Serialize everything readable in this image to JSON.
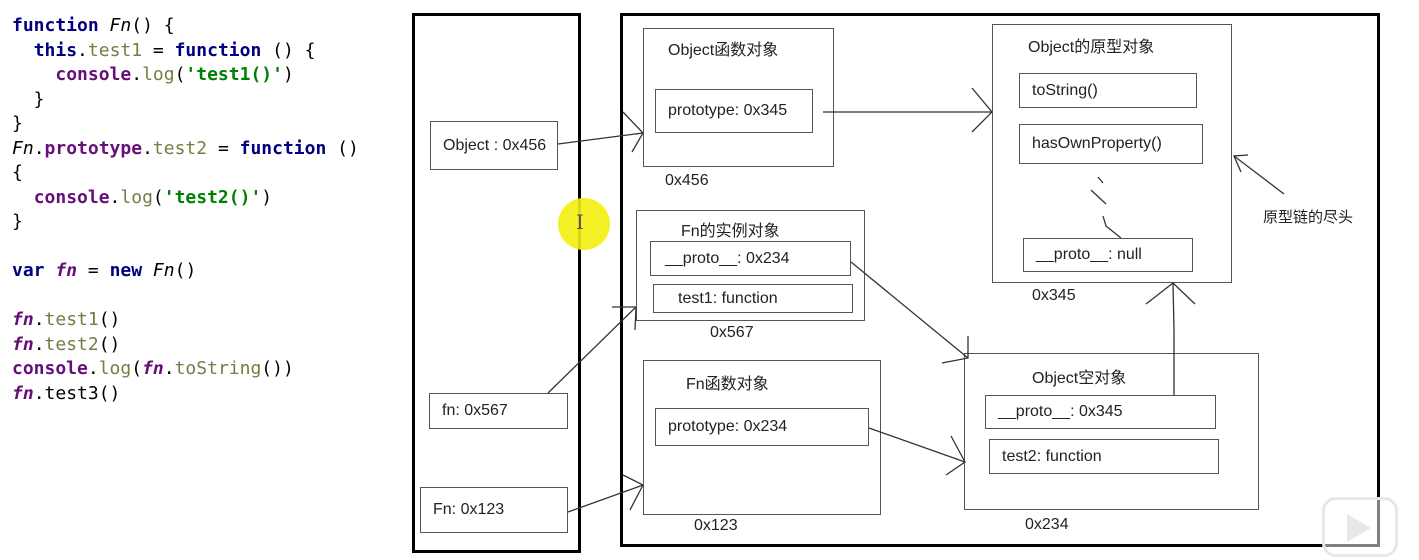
{
  "code": {
    "lines": [
      [
        {
          "t": "function",
          "c": "kw"
        },
        {
          "t": " ",
          "c": "plain"
        },
        {
          "t": "Fn",
          "c": "fnname"
        },
        {
          "t": "() {",
          "c": "plain"
        }
      ],
      [
        {
          "t": "  ",
          "c": "plain"
        },
        {
          "t": "this",
          "c": "kw"
        },
        {
          "t": ".",
          "c": "plain"
        },
        {
          "t": "test1",
          "c": "prop"
        },
        {
          "t": " = ",
          "c": "plain"
        },
        {
          "t": "function",
          "c": "kw"
        },
        {
          "t": " () {",
          "c": "plain"
        }
      ],
      [
        {
          "t": "    ",
          "c": "plain"
        },
        {
          "t": "console",
          "c": "obj"
        },
        {
          "t": ".",
          "c": "plain"
        },
        {
          "t": "log",
          "c": "prop"
        },
        {
          "t": "(",
          "c": "plain"
        },
        {
          "t": "'test1()'",
          "c": "str"
        },
        {
          "t": ")",
          "c": "plain"
        }
      ],
      [
        {
          "t": "  }",
          "c": "plain"
        }
      ],
      [
        {
          "t": "}",
          "c": "plain"
        }
      ],
      [
        {
          "t": "Fn",
          "c": "fnname"
        },
        {
          "t": ".",
          "c": "plain"
        },
        {
          "t": "prototype",
          "c": "obj"
        },
        {
          "t": ".",
          "c": "plain"
        },
        {
          "t": "test2",
          "c": "prop"
        },
        {
          "t": " = ",
          "c": "plain"
        },
        {
          "t": "function",
          "c": "kw"
        },
        {
          "t": " ()",
          "c": "plain"
        }
      ],
      [
        {
          "t": "{",
          "c": "plain"
        }
      ],
      [
        {
          "t": "  ",
          "c": "plain"
        },
        {
          "t": "console",
          "c": "obj"
        },
        {
          "t": ".",
          "c": "plain"
        },
        {
          "t": "log",
          "c": "prop"
        },
        {
          "t": "(",
          "c": "plain"
        },
        {
          "t": "'test2()'",
          "c": "str"
        },
        {
          "t": ")",
          "c": "plain"
        }
      ],
      [
        {
          "t": "}",
          "c": "plain"
        }
      ],
      [
        {
          "t": "",
          "c": "plain"
        }
      ],
      [
        {
          "t": "var",
          "c": "kw"
        },
        {
          "t": " ",
          "c": "plain"
        },
        {
          "t": "fn",
          "c": "var"
        },
        {
          "t": " = ",
          "c": "plain"
        },
        {
          "t": "new",
          "c": "kw"
        },
        {
          "t": " ",
          "c": "plain"
        },
        {
          "t": "Fn",
          "c": "fnname"
        },
        {
          "t": "()",
          "c": "plain"
        }
      ],
      [
        {
          "t": "",
          "c": "plain"
        }
      ],
      [
        {
          "t": "fn",
          "c": "var"
        },
        {
          "t": ".",
          "c": "plain"
        },
        {
          "t": "test1",
          "c": "prop"
        },
        {
          "t": "()",
          "c": "plain"
        }
      ],
      [
        {
          "t": "fn",
          "c": "var"
        },
        {
          "t": ".",
          "c": "plain"
        },
        {
          "t": "test2",
          "c": "prop"
        },
        {
          "t": "()",
          "c": "plain"
        }
      ],
      [
        {
          "t": "console",
          "c": "obj"
        },
        {
          "t": ".",
          "c": "plain"
        },
        {
          "t": "log",
          "c": "prop"
        },
        {
          "t": "(",
          "c": "plain"
        },
        {
          "t": "fn",
          "c": "var"
        },
        {
          "t": ".",
          "c": "plain"
        },
        {
          "t": "toString",
          "c": "prop"
        },
        {
          "t": "())",
          "c": "plain"
        }
      ],
      [
        {
          "t": "fn",
          "c": "var"
        },
        {
          "t": ".test3()",
          "c": "plain"
        }
      ]
    ]
  },
  "stack": {
    "vars": [
      "Object : 0x456",
      "fn: 0x567",
      "Fn: 0x123"
    ]
  },
  "heap": {
    "object_function": {
      "title": "Object函数对象",
      "prop": "prototype: 0x345",
      "addr": "0x456"
    },
    "object_prototype": {
      "title": "Object的原型对象",
      "props": [
        "toString()",
        "hasOwnProperty()",
        "__proto__: null"
      ],
      "addr": "0x345"
    },
    "fn_instance": {
      "title": "Fn的实例对象",
      "props": [
        "__proto__: 0x234",
        "test1: function"
      ],
      "addr": "0x567"
    },
    "fn_function": {
      "title": "Fn函数对象",
      "prop": "prototype: 0x234",
      "addr": "0x123"
    },
    "object_empty": {
      "title": "Object空对象",
      "props": [
        "__proto__: 0x345",
        "test2: function"
      ],
      "addr": "0x234"
    },
    "annotation": "原型链的尽头"
  },
  "colors": {
    "keyword": "#000080",
    "string": "#008000",
    "object": "#660e7a",
    "property": "#7a7a43",
    "cursor": "#f5ee10"
  }
}
